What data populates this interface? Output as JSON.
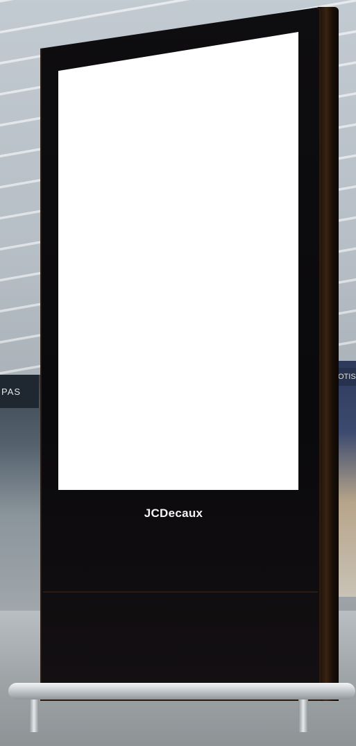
{
  "scene": {
    "kiosk": {
      "brand_logo": "JCDecaux",
      "screen_state": "blank-white"
    },
    "background_signs": {
      "left_store": "PAS",
      "right_store": "OTIS"
    }
  }
}
